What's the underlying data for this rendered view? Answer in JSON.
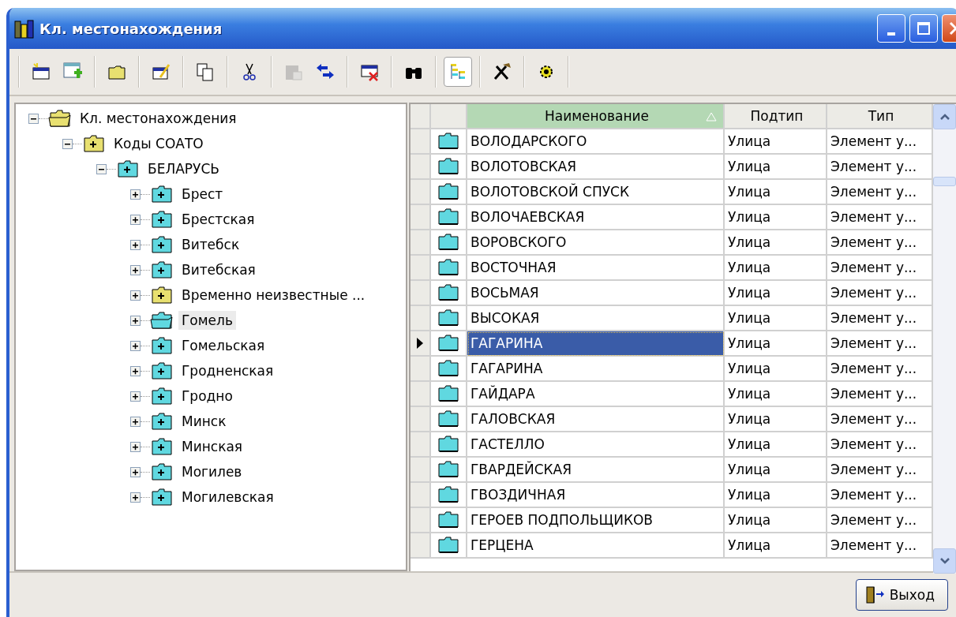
{
  "window": {
    "title": "Кл. местонахождения"
  },
  "toolbar": [
    [
      {
        "kind": "new-record",
        "pressed": false,
        "disabled": false
      },
      {
        "kind": "add-table",
        "pressed": false,
        "disabled": false
      }
    ],
    [
      {
        "kind": "folder",
        "pressed": false,
        "disabled": false
      }
    ],
    [
      {
        "kind": "edit",
        "pressed": false,
        "disabled": false
      }
    ],
    [
      {
        "kind": "copy",
        "pressed": false,
        "disabled": false
      }
    ],
    [
      {
        "kind": "cut",
        "pressed": false,
        "disabled": false
      }
    ],
    [
      {
        "kind": "paste",
        "pressed": false,
        "disabled": true
      },
      {
        "kind": "arrows",
        "pressed": false,
        "disabled": false
      }
    ],
    [
      {
        "kind": "delete-record",
        "pressed": false,
        "disabled": false
      }
    ],
    [
      {
        "kind": "find",
        "pressed": false,
        "disabled": false
      }
    ],
    [
      {
        "kind": "tree-view",
        "pressed": true,
        "disabled": false
      }
    ],
    [
      {
        "kind": "tools",
        "pressed": false,
        "disabled": false
      }
    ],
    [
      {
        "kind": "settings",
        "pressed": false,
        "disabled": false
      }
    ]
  ],
  "tree": [
    {
      "label": "Кл. местонахождения",
      "expanded": true,
      "open": true,
      "color": "#e8e070",
      "selected": false,
      "children": [
        {
          "label": "Коды СОАТО",
          "expanded": true,
          "open": false,
          "color": "#e8e070",
          "selected": false,
          "children": [
            {
              "label": "БЕЛАРУСЬ",
              "expanded": true,
              "open": false,
              "color": "#60d8e0",
              "selected": false,
              "children": [
                {
                  "label": "Брест",
                  "expanded": false,
                  "open": false,
                  "color": "#60d8e0",
                  "selected": false
                },
                {
                  "label": "Брестская",
                  "expanded": false,
                  "open": false,
                  "color": "#60d8e0",
                  "selected": false
                },
                {
                  "label": "Витебск",
                  "expanded": false,
                  "open": false,
                  "color": "#60d8e0",
                  "selected": false
                },
                {
                  "label": "Витебская",
                  "expanded": false,
                  "open": false,
                  "color": "#60d8e0",
                  "selected": false
                },
                {
                  "label": "Временно неизвестные ...",
                  "expanded": false,
                  "open": false,
                  "color": "#e8e070",
                  "selected": false
                },
                {
                  "label": "Гомель",
                  "expanded": false,
                  "open": true,
                  "color": "#60d8e0",
                  "selected": true
                },
                {
                  "label": "Гомельская",
                  "expanded": false,
                  "open": false,
                  "color": "#60d8e0",
                  "selected": false
                },
                {
                  "label": "Гродненская",
                  "expanded": false,
                  "open": false,
                  "color": "#60d8e0",
                  "selected": false
                },
                {
                  "label": "Гродно",
                  "expanded": false,
                  "open": false,
                  "color": "#60d8e0",
                  "selected": false
                },
                {
                  "label": "Минск",
                  "expanded": false,
                  "open": false,
                  "color": "#60d8e0",
                  "selected": false
                },
                {
                  "label": "Минская",
                  "expanded": false,
                  "open": false,
                  "color": "#60d8e0",
                  "selected": false
                },
                {
                  "label": "Могилев",
                  "expanded": false,
                  "open": false,
                  "color": "#60d8e0",
                  "selected": false
                },
                {
                  "label": "Могилевская",
                  "expanded": false,
                  "open": false,
                  "color": "#60d8e0",
                  "selected": false
                }
              ]
            }
          ]
        }
      ]
    }
  ],
  "table": {
    "columns": [
      {
        "label": "Наименование",
        "sorted": true
      },
      {
        "label": "Подтип",
        "sorted": false
      },
      {
        "label": "Тип",
        "sorted": false
      }
    ],
    "rows": [
      {
        "name": "ВОЛОДАРСКОГО",
        "subtype": "Улица",
        "type": "Элемент у...",
        "selected": false
      },
      {
        "name": "ВОЛОТОВСКАЯ",
        "subtype": "Улица",
        "type": "Элемент у...",
        "selected": false
      },
      {
        "name": "ВОЛОТОВСКОЙ СПУСК",
        "subtype": "Улица",
        "type": "Элемент у...",
        "selected": false
      },
      {
        "name": "ВОЛОЧАЕВСКАЯ",
        "subtype": "Улица",
        "type": "Элемент у...",
        "selected": false
      },
      {
        "name": "ВОРОВСКОГО",
        "subtype": "Улица",
        "type": "Элемент у...",
        "selected": false
      },
      {
        "name": "ВОСТОЧНАЯ",
        "subtype": "Улица",
        "type": "Элемент у...",
        "selected": false
      },
      {
        "name": "ВОСЬМАЯ",
        "subtype": "Улица",
        "type": "Элемент у...",
        "selected": false
      },
      {
        "name": "ВЫСОКАЯ",
        "subtype": "Улица",
        "type": "Элемент у...",
        "selected": false
      },
      {
        "name": "ГАГАРИНА",
        "subtype": "Улица",
        "type": "Элемент у...",
        "selected": true
      },
      {
        "name": "ГАГАРИНА",
        "subtype": "Улица",
        "type": "Элемент у...",
        "selected": false
      },
      {
        "name": "ГАЙДАРА",
        "subtype": "Улица",
        "type": "Элемент у...",
        "selected": false
      },
      {
        "name": "ГАЛОВСКАЯ",
        "subtype": "Улица",
        "type": "Элемент у...",
        "selected": false
      },
      {
        "name": "ГАСТЕЛЛО",
        "subtype": "Улица",
        "type": "Элемент у...",
        "selected": false
      },
      {
        "name": "ГВАРДЕЙСКАЯ",
        "subtype": "Улица",
        "type": "Элемент у...",
        "selected": false
      },
      {
        "name": "ГВОЗДИЧНАЯ",
        "subtype": "Улица",
        "type": "Элемент у...",
        "selected": false
      },
      {
        "name": "ГЕРОЕВ ПОДПОЛЬЩИКОВ",
        "subtype": "Улица",
        "type": "Элемент у...",
        "selected": false
      },
      {
        "name": "ГЕРЦЕНА",
        "subtype": "Улица",
        "type": "Элемент у...",
        "selected": false
      }
    ]
  },
  "exit_button": {
    "label": "Выход"
  }
}
